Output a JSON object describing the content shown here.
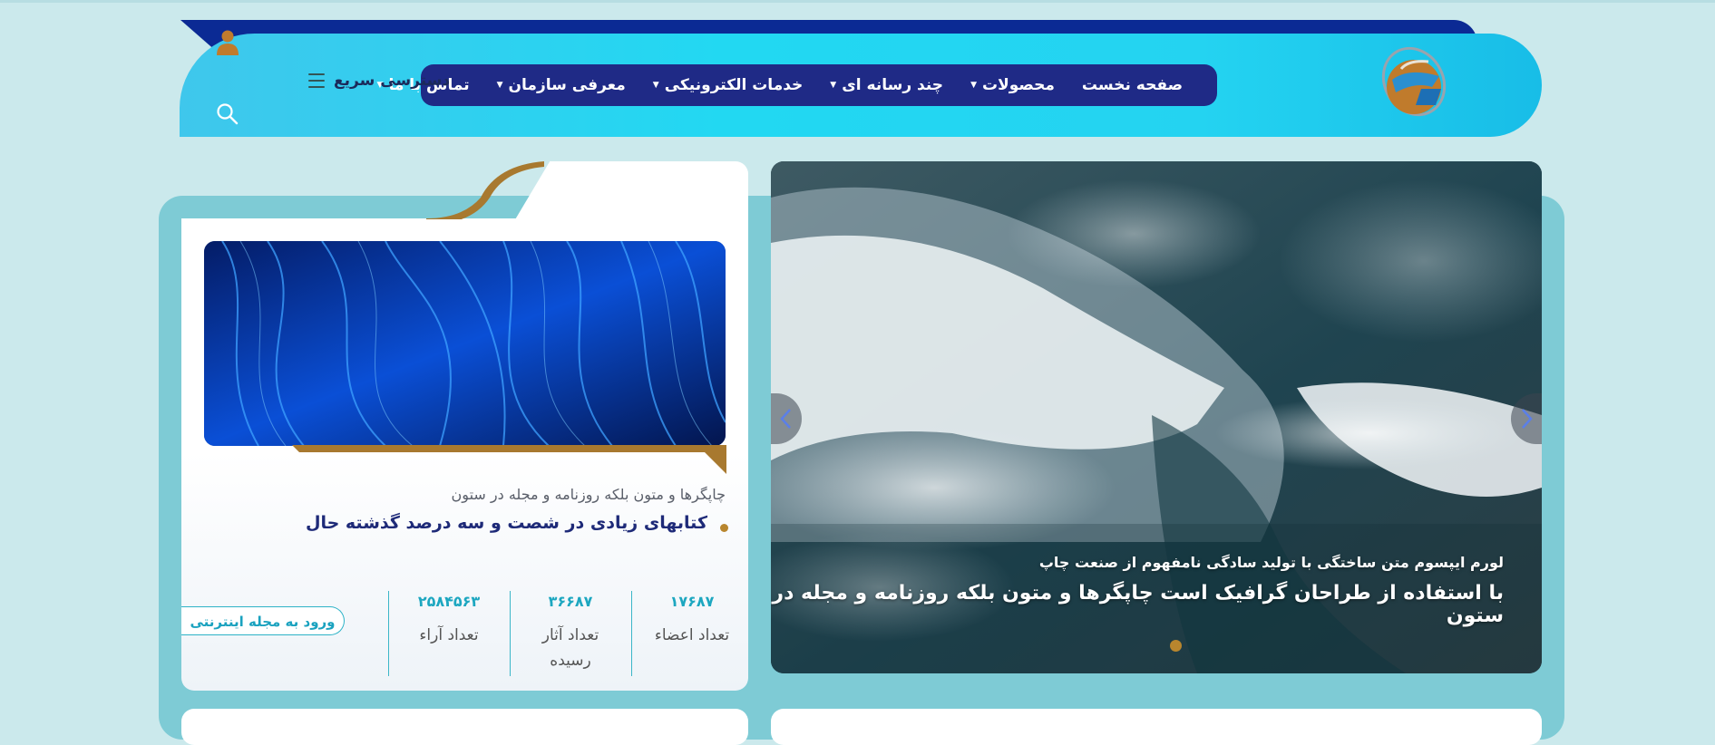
{
  "colors": {
    "background": "#cbe9ec",
    "header_cyan": "#22d8f2",
    "header_navy": "#0b2a94",
    "nav_pill": "#1f2a86",
    "panel": "#7ecbd5",
    "gold": "#b8862e",
    "title_navy": "#1e2a78",
    "stat_teal": "#1da7c0"
  },
  "header": {
    "logo_icon": "site-logo-globe-g",
    "user_icon": "user-icon",
    "search_icon": "search-icon",
    "quick_access": {
      "label": "دسترسی سریع",
      "icon": "hamburger-icon"
    },
    "nav": [
      {
        "label": "صفحه نخست",
        "has_dropdown": false
      },
      {
        "label": "محصولات",
        "has_dropdown": true
      },
      {
        "label": "چند رسانه ای",
        "has_dropdown": true
      },
      {
        "label": "خدمات الکترونیکی",
        "has_dropdown": true
      },
      {
        "label": "معرفی سازمان",
        "has_dropdown": true
      },
      {
        "label": "تماس با ما",
        "has_dropdown": true
      }
    ]
  },
  "magazine_card": {
    "subtitle": "چاپگرها و متون بلکه روزنامه و مجله در ستون",
    "title": "کتابهای زیادی در شصت و سه درصد گذشته حال",
    "stats": [
      {
        "value": "۱۷۶۸۷",
        "label": "تعداد اعضاء"
      },
      {
        "value": "۳۶۶۸۷",
        "label": "تعداد آثار رسیده"
      },
      {
        "value": "۲۵۸۴۵۶۳",
        "label": "تعداد آراء"
      }
    ],
    "enter_button": "ورود به مجله اینترنتی"
  },
  "slider": {
    "caption_small": "لورم ایپسوم متن ساختگی با تولید سادگی نامفهوم از صنعت چاپ",
    "caption_large": "با استفاده از طراحان گرافیک است چاپگرها و متون بلکه روزنامه و مجله در ستون",
    "prev_icon": "chevron-left-icon",
    "next_icon": "chevron-right-icon",
    "active_slide": 1,
    "slide_count": 1
  }
}
